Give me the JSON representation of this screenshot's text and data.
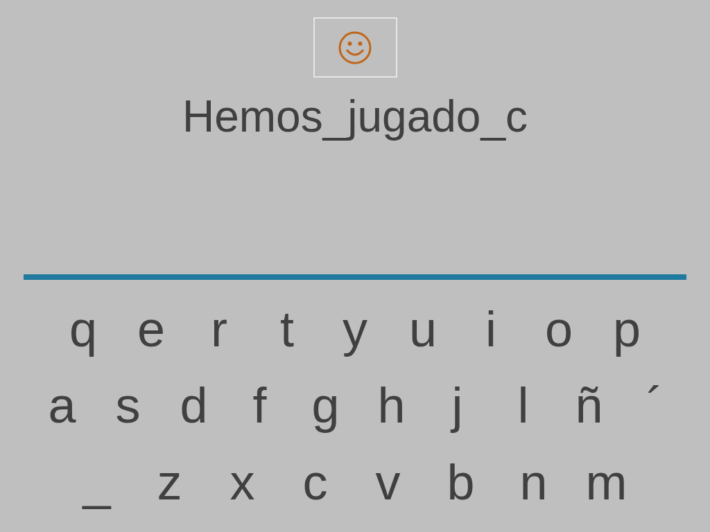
{
  "answer": "Hemos_jugado_c",
  "keyboard_rows": [
    [
      "q",
      "e",
      "r",
      "t",
      "y",
      "u",
      "i",
      "o",
      "p"
    ],
    [
      "a",
      "s",
      "d",
      "f",
      "g",
      "h",
      "j",
      "l",
      "ñ",
      "´"
    ],
    [
      "_",
      "z",
      "x",
      "c",
      "v",
      "b",
      "n",
      "m"
    ]
  ]
}
